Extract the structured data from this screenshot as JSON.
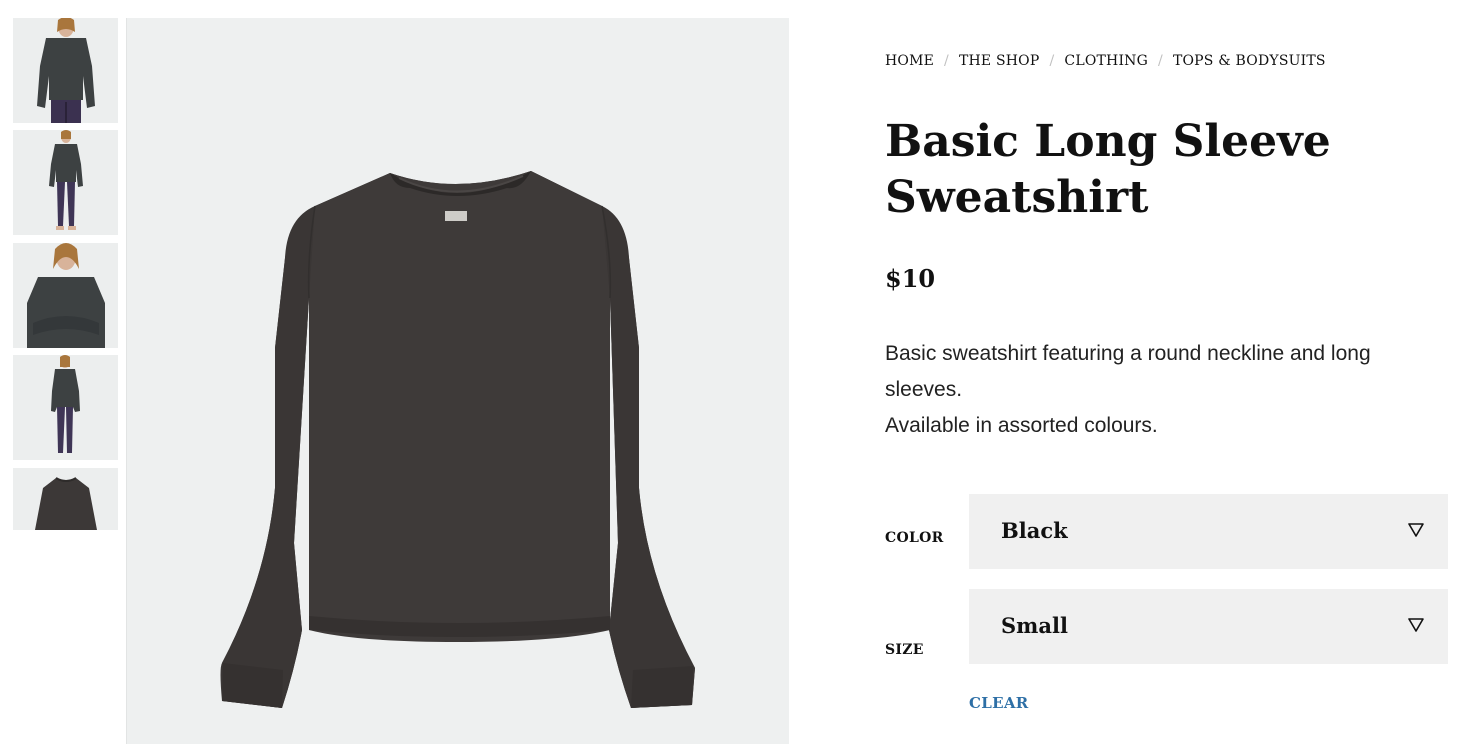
{
  "breadcrumb": {
    "items": [
      "HOME",
      "THE SHOP",
      "CLOTHING",
      "TOPS & BODYSUITS"
    ],
    "separator": "/"
  },
  "product": {
    "title": "Basic Long Sleeve Sweatshirt",
    "price": "$10",
    "description_lines": [
      "Basic sweatshirt featuring a round neckline and long sleeves.",
      "Available in assorted colours."
    ]
  },
  "options": {
    "color": {
      "label": "COLOR",
      "selected": "Black"
    },
    "size": {
      "label": "SIZE",
      "selected": "Small"
    },
    "clear_label": "CLEAR"
  },
  "colors": {
    "link": "#2d6fa6",
    "select_bg": "#f0f0f0",
    "garment": "#3c3837",
    "image_bg": "#eef0f0"
  },
  "icons": {
    "select_arrow": "triangle-down-icon"
  }
}
